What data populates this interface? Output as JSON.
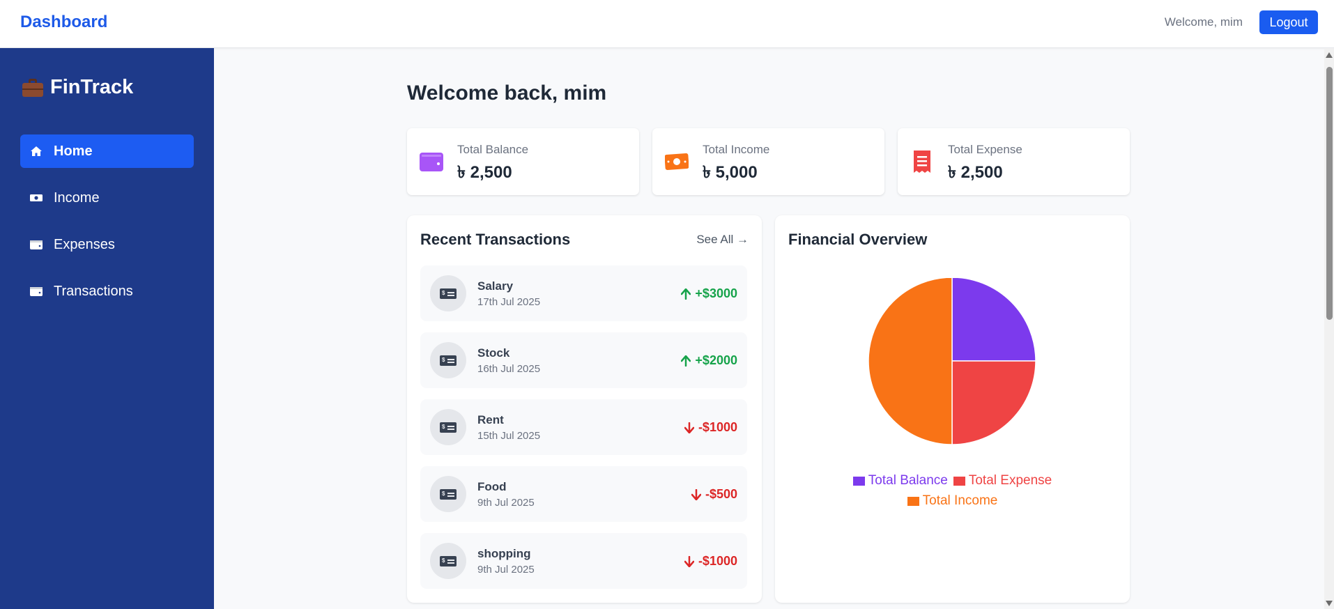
{
  "topbar": {
    "brand": "Dashboard",
    "welcome": "Welcome, mim",
    "logout_label": "Logout"
  },
  "sidebar": {
    "logo_text": "FinTrack",
    "logo_icon": "briefcase-icon",
    "items": [
      {
        "label": "Home",
        "icon": "home-icon",
        "active": true
      },
      {
        "label": "Income",
        "icon": "money-bill-icon",
        "active": false
      },
      {
        "label": "Expenses",
        "icon": "wallet-icon",
        "active": false
      },
      {
        "label": "Transactions",
        "icon": "wallet-icon",
        "active": false
      }
    ]
  },
  "main": {
    "heading": "Welcome back, mim",
    "stats": [
      {
        "label": "Total Balance",
        "value": "৳ 2,500",
        "icon": "wallet-icon",
        "color": "#a855f7"
      },
      {
        "label": "Total Income",
        "value": "৳ 5,000",
        "icon": "money-bill-icon",
        "color": "#f97316"
      },
      {
        "label": "Total Expense",
        "value": "৳ 2,500",
        "icon": "receipt-icon",
        "color": "#ef4444"
      }
    ],
    "recent": {
      "title": "Recent Transactions",
      "see_all": "See All →",
      "items": [
        {
          "name": "Salary",
          "date": "17th Jul 2025",
          "amount": "+$3000",
          "direction": "up"
        },
        {
          "name": "Stock",
          "date": "16th Jul 2025",
          "amount": "+$2000",
          "direction": "up"
        },
        {
          "name": "Rent",
          "date": "15th Jul 2025",
          "amount": "-$1000",
          "direction": "down"
        },
        {
          "name": "Food",
          "date": "9th Jul 2025",
          "amount": "-$500",
          "direction": "down"
        },
        {
          "name": "shopping",
          "date": "9th Jul 2025",
          "amount": "-$1000",
          "direction": "down"
        }
      ]
    },
    "overview": {
      "title": "Financial Overview"
    }
  },
  "colors": {
    "accent": "#1d5cf2",
    "sidebar": "#1e3a8a",
    "income_up": "#16a34a",
    "expense_down": "#dc2626"
  },
  "chart_data": {
    "type": "pie",
    "title": "",
    "categories": [
      "Total Balance",
      "Total Expense",
      "Total Income"
    ],
    "values": [
      2500,
      2500,
      5000
    ],
    "colors": [
      "#7c3aed",
      "#ef4444",
      "#f97316"
    ],
    "legend_position": "bottom"
  }
}
